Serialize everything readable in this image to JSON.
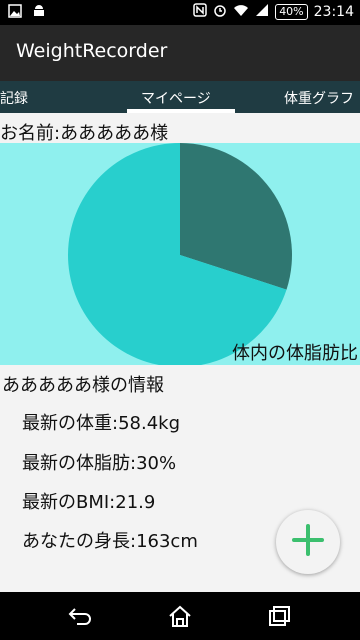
{
  "status_bar": {
    "time": "23:14",
    "battery": "40%",
    "network": "4G"
  },
  "app": {
    "title": "WeightRecorder"
  },
  "tabs": [
    {
      "label": "記録"
    },
    {
      "label": "マイページ"
    },
    {
      "label": "体重グラフ"
    }
  ],
  "profile": {
    "name_line": "お名前:あああああ様"
  },
  "chart_data": {
    "type": "pie",
    "title": "体内の体脂肪比",
    "values": [
      30,
      70
    ],
    "colors": [
      "#2f7771",
      "#28cfcd"
    ]
  },
  "info": {
    "heading": "あああああ様の情報",
    "weight": "最新の体重:58.4kg",
    "body_fat": "最新の体脂肪:30%",
    "bmi": "最新のBMI:21.9",
    "height": "あなたの身長:163cm"
  },
  "colors": {
    "accent": "#3bbf6e",
    "tab_bar": "#1f3b42",
    "chart_bg": "#8ff0ee"
  }
}
